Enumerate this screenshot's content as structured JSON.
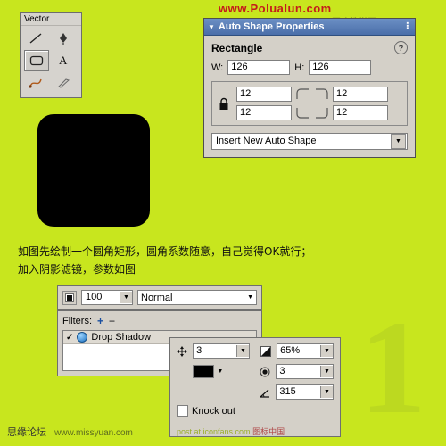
{
  "watermarks": {
    "top_url": "www.PoluaIun.com",
    "top_cn": "网络教学网",
    "bottom_left": "思缘论坛",
    "bottom_left_url": "www.missyuan.com",
    "bottom_mid": "post at iconfans.com",
    "bottom_mid_cn": "图标中国",
    "big_number": "1"
  },
  "vector_panel": {
    "title": "Vector",
    "tools": [
      {
        "name": "line-tool",
        "label": "Line"
      },
      {
        "name": "pen-tool",
        "label": "Pen"
      },
      {
        "name": "rectangle-tool",
        "label": "Rectangle",
        "selected": true
      },
      {
        "name": "text-tool",
        "label": "A"
      },
      {
        "name": "freeform-tool",
        "label": "Freeform"
      },
      {
        "name": "knife-tool",
        "label": "Knife"
      }
    ]
  },
  "auto_shape_panel": {
    "title": "Auto Shape Properties",
    "section": "Rectangle",
    "help_glyph": "?",
    "collapse_glyph": "▼",
    "grip_glyph": "⠇",
    "width_label": "W:",
    "width_value": "126",
    "height_label": "H:",
    "height_value": "126",
    "corners": {
      "top_left": "12",
      "top_right": "12",
      "bottom_left": "12",
      "bottom_right": "12",
      "lock_icon": "lock-closed"
    },
    "insert_combo": "Insert New Auto Shape",
    "combo_arrow": "▼"
  },
  "instructions": {
    "line1": "如图先绘制一个圆角矩形，圆角系数随意，自己觉得OK就行；",
    "line2": "加入阴影滤镜，参数如图"
  },
  "layer_bar": {
    "opacity_value": "100",
    "blend_mode": "Normal",
    "spin_arrow": "▼"
  },
  "filters_panel": {
    "label": "Filters:",
    "add_glyph": "+",
    "remove_glyph": "−",
    "items": [
      {
        "checked": "✓",
        "name": "Drop Shadow"
      }
    ]
  },
  "drop_shadow": {
    "distance_icon": "move-arrows-icon",
    "distance_value": "3",
    "opacity_icon": "opacity-icon",
    "opacity_value": "65%",
    "color_swatch": "#000000",
    "softness_icon": "softness-icon",
    "softness_value": "3",
    "angle_icon": "angle-icon",
    "angle_value": "315",
    "knock_out_label": "Knock out",
    "arrow_glyph": "▼"
  },
  "colors": {
    "background": "#c8e61e",
    "panel": "#d4d0c8",
    "titlebar": "#4a6ea9",
    "shape": "#000000"
  }
}
